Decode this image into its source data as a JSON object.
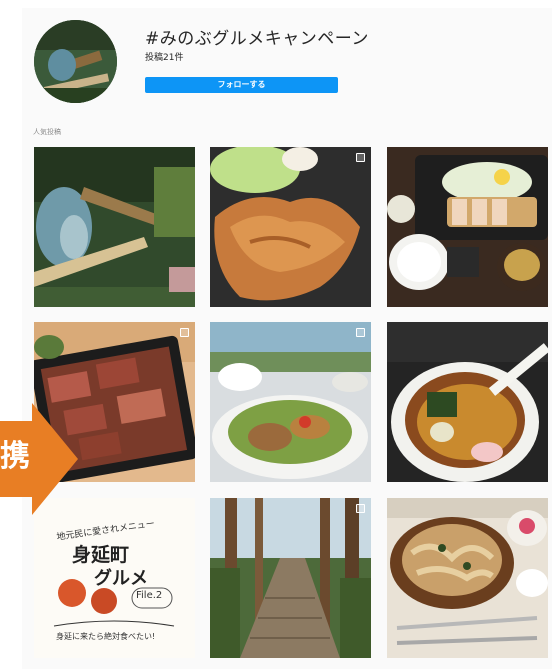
{
  "profile": {
    "hashtag": "#みのぶグルメキャンペーン",
    "post_count": "投稿21件",
    "follow_label": "フォローする"
  },
  "section_title": "人気投稿",
  "overlay_label": "携",
  "grid": [
    {
      "name": "waterfall-photo"
    },
    {
      "name": "fried-chicken-photo"
    },
    {
      "name": "tonkatsu-set-photo"
    },
    {
      "name": "steak-box-photo"
    },
    {
      "name": "salad-lunch-photo"
    },
    {
      "name": "ramen-photo"
    },
    {
      "name": "gourmet-file2-graphic",
      "text": {
        "line1": "地元民に愛されメニュー",
        "line2": "身延町",
        "line3": "グルメ",
        "line4": "File.2",
        "line5": "身延に来たら絶対食べたい!"
      }
    },
    {
      "name": "forest-stairs-photo"
    },
    {
      "name": "hoto-noodles-photo"
    }
  ],
  "colors": {
    "follow_button": "#0d95f6",
    "arrow": "#e87e24"
  }
}
